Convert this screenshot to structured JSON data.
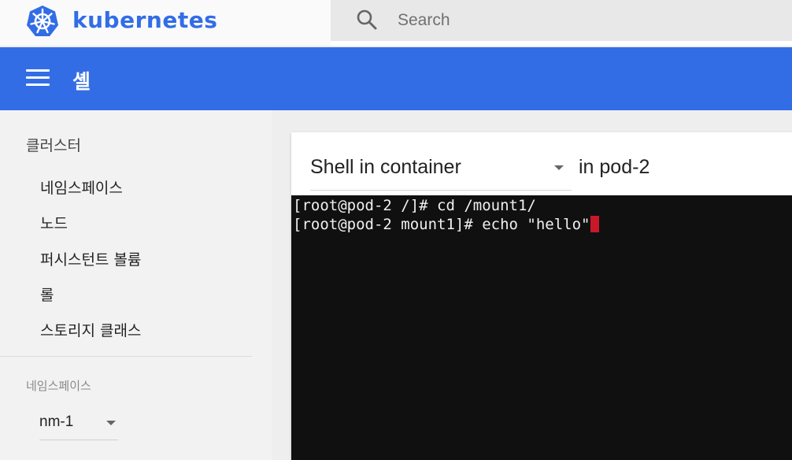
{
  "header": {
    "brand": "kubernetes",
    "search_placeholder": "Search"
  },
  "toolbar": {
    "title": "셸"
  },
  "sidebar": {
    "section": "클러스터",
    "items": [
      {
        "label": "네임스페이스"
      },
      {
        "label": "노드"
      },
      {
        "label": "퍼시스턴트 볼륨"
      },
      {
        "label": "롤"
      },
      {
        "label": "스토리지 클래스"
      }
    ],
    "namespace_label": "네임스페이스",
    "namespace_value": "nm-1"
  },
  "main": {
    "container_select": "Shell in container",
    "pod_text": "in pod-2",
    "terminal": {
      "lines": [
        "[root@pod-2 /]# cd /mount1/",
        "[root@pod-2 mount1]# echo \"hello\""
      ],
      "cursor_color": "#c8192a"
    }
  },
  "colors": {
    "brand": "#326de6",
    "terminal_bg": "#101010"
  }
}
